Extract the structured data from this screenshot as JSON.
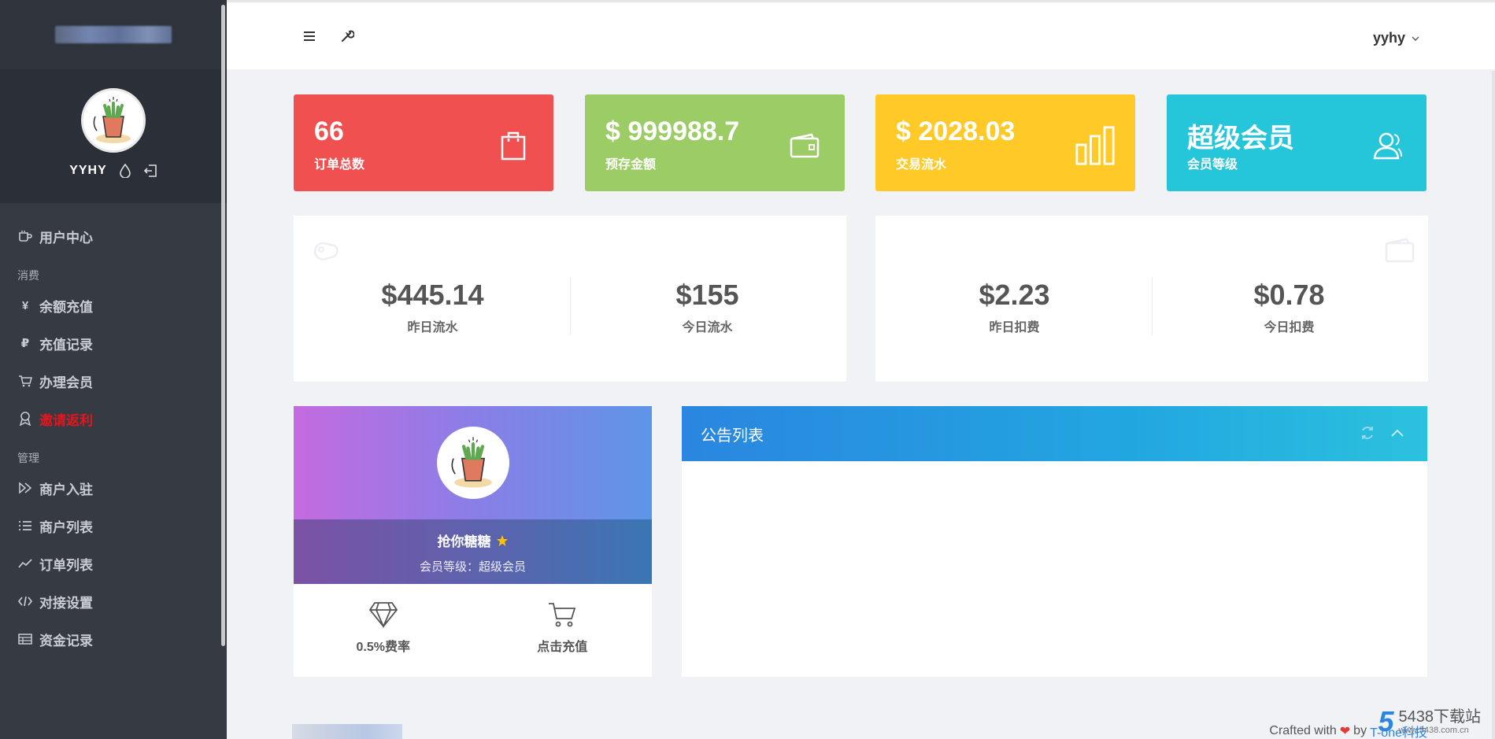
{
  "sidebar": {
    "profile_name": "YYHY",
    "menu": [
      {
        "label": "用户中心",
        "icon": "cup-icon"
      },
      {
        "label": "余额充值",
        "icon": "yen-icon"
      },
      {
        "label": "充值记录",
        "icon": "ruble-icon"
      },
      {
        "label": "办理会员",
        "icon": "cart-icon"
      },
      {
        "label": "邀请返利",
        "icon": "badge-icon",
        "color": "#e3161c"
      },
      {
        "label": "商户入驻",
        "icon": "play-outline-icon"
      },
      {
        "label": "商户列表",
        "icon": "list-icon"
      },
      {
        "label": "订单列表",
        "icon": "trend-icon"
      },
      {
        "label": "对接设置",
        "icon": "code-icon"
      },
      {
        "label": "资金记录",
        "icon": "table-icon"
      }
    ],
    "sections": {
      "consume": "消费",
      "manage": "管理"
    }
  },
  "header": {
    "user": "yyhy"
  },
  "tiles": [
    {
      "value": "66",
      "label": "订单总数",
      "color": "#f05050",
      "icon": "bag-icon"
    },
    {
      "value": "$ 999988.7",
      "label": "预存金额",
      "color": "#9ccc65",
      "icon": "wallet-icon"
    },
    {
      "value": "$ 2028.03",
      "label": "交易流水",
      "color": "#ffca28",
      "icon": "bar-chart-icon"
    },
    {
      "value": "超级会员",
      "label": "会员等级",
      "color": "#26c6da",
      "icon": "users-icon"
    }
  ],
  "flow": {
    "yesterday_value": "$445.14",
    "yesterday_label": "昨日流水",
    "today_value": "$155",
    "today_label": "今日流水"
  },
  "fee": {
    "yesterday_value": "$2.23",
    "yesterday_label": "昨日扣费",
    "today_value": "$0.78",
    "today_label": "今日扣费"
  },
  "profile_card": {
    "name": "抢你糖糖",
    "level": "会员等级：超级会员",
    "rate_label": "0.5%费率",
    "recharge_label": "点击充值"
  },
  "announcement": {
    "title": "公告列表"
  },
  "footer": {
    "crafted": "Crafted with",
    "by": "by",
    "brand": "T-one科技"
  },
  "watermark": {
    "digit": "5",
    "name": "5438下载站",
    "url": "www.5438.com.cn"
  }
}
